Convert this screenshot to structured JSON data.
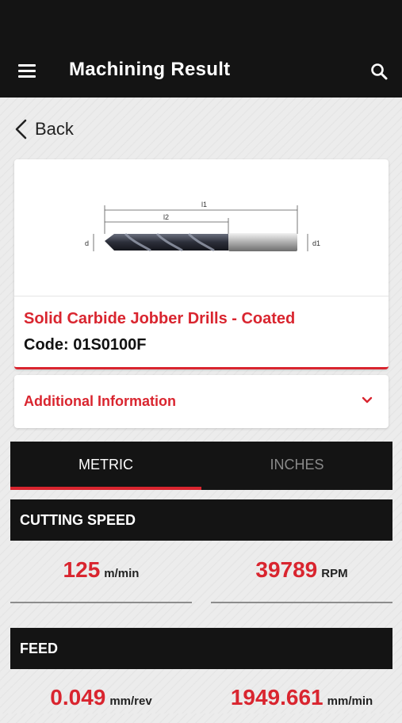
{
  "header": {
    "title": "Machining Result",
    "menu_icon": "hamburger-menu-icon",
    "search_icon": "search-icon"
  },
  "nav": {
    "back_label": "Back"
  },
  "product": {
    "name": "Solid Carbide Jobber Drills - Coated",
    "code": "Code: 01S0100F",
    "diagram_labels": {
      "l1": "l1",
      "l2": "l2",
      "d": "d",
      "d1": "d1"
    }
  },
  "additional_info": {
    "label": "Additional Information"
  },
  "unit_tabs": {
    "metric": "METRIC",
    "inches": "INCHES",
    "active": "METRIC"
  },
  "cutting_speed": {
    "title": "CUTTING SPEED",
    "surface_speed": {
      "value": "125",
      "unit": "m/min"
    },
    "spindle_speed": {
      "value": "39789",
      "unit": "RPM"
    }
  },
  "feed": {
    "title": "FEED",
    "per_rev": {
      "value": "0.049",
      "unit": "mm/rev"
    },
    "per_min": {
      "value": "1949.661",
      "unit": "mm/min"
    }
  },
  "colors": {
    "accent": "#d9252f",
    "bar": "#141414"
  }
}
